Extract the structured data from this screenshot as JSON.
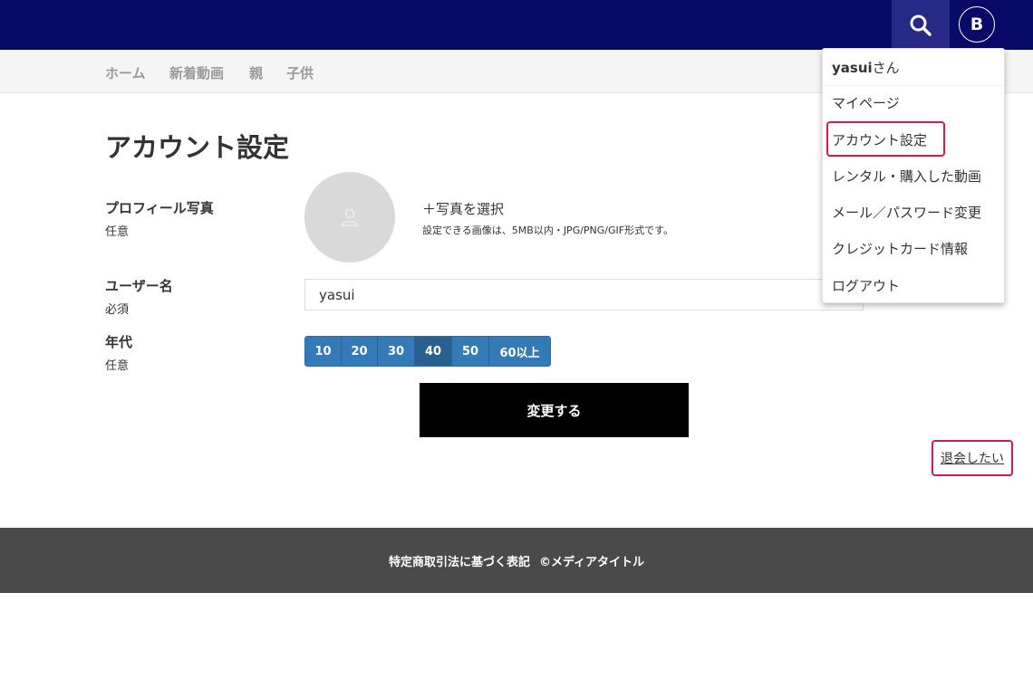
{
  "header": {
    "avatar_initial": "B",
    "icons": {
      "search": "search-icon"
    }
  },
  "nav": {
    "items": [
      "ホーム",
      "新着動画",
      "親",
      "子供"
    ]
  },
  "page": {
    "title": "アカウント設定"
  },
  "form": {
    "photo": {
      "label": "プロフィール写真",
      "note": "任意",
      "select_label": "＋写真を選択",
      "hint": "設定できる画像は、5MB以内・JPG/PNG/GIF形式です。"
    },
    "username": {
      "label": "ユーザー名",
      "note": "必須",
      "value": "yasui"
    },
    "age": {
      "label": "年代",
      "note": "任意",
      "options": [
        "10",
        "20",
        "30",
        "40",
        "50",
        "60以上"
      ],
      "selected": "40"
    },
    "submit_label": "変更する",
    "withdraw_label": "退会したい"
  },
  "dropdown": {
    "user_name": "yasui",
    "user_suffix": "さん",
    "items": [
      "マイページ",
      "アカウント設定",
      "レンタル・購入した動画",
      "メール／パスワード変更",
      "クレジットカード情報",
      "ログアウト"
    ],
    "highlighted": "アカウント設定"
  },
  "footer": {
    "legal_label": "特定商取引法に基づく表記",
    "copyright": "©メディアタイトル"
  },
  "colors": {
    "header_bg": "#070a66",
    "accent_blue": "#337ab7",
    "highlight_red": "#d6194d",
    "footer_bg": "#4a4a4a"
  }
}
